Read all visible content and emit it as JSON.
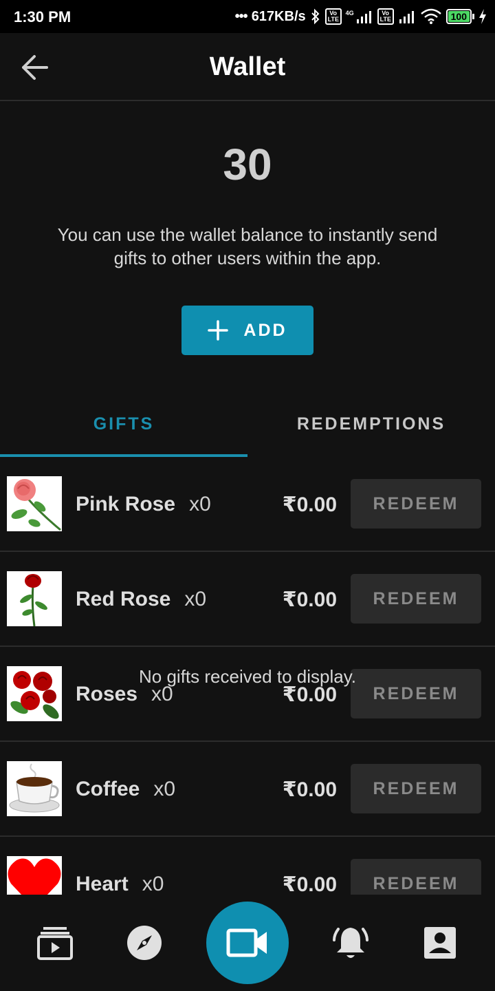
{
  "status_bar": {
    "time": "1:30 PM",
    "network_speed": "617KB/s",
    "battery": "100",
    "net_label": "4G",
    "volte_1": "Vo LTE",
    "volte_2": "Vo LTE"
  },
  "app_bar": {
    "title": "Wallet"
  },
  "wallet": {
    "balance": "30",
    "description": "You can use the wallet balance to instantly send gifts to other users within the app.",
    "add_label": "ADD"
  },
  "tabs": [
    {
      "label": "GIFTS",
      "active": true
    },
    {
      "label": "REDEMPTIONS",
      "active": false
    }
  ],
  "accent_color": "#0f8fb0",
  "gifts": [
    {
      "name": "Pink Rose",
      "qty": "x0",
      "price": "₹0.00",
      "action": "REDEEM",
      "icon": "pink-rose-icon"
    },
    {
      "name": "Red Rose",
      "qty": "x0",
      "price": "₹0.00",
      "action": "REDEEM",
      "icon": "red-rose-icon"
    },
    {
      "name": "Roses",
      "qty": "x0",
      "price": "₹0.00",
      "action": "REDEEM",
      "icon": "roses-bouquet-icon"
    },
    {
      "name": "Coffee",
      "qty": "x0",
      "price": "₹0.00",
      "action": "REDEEM",
      "icon": "coffee-cup-icon"
    },
    {
      "name": "Heart",
      "qty": "x0",
      "price": "₹0.00",
      "action": "REDEEM",
      "icon": "heart-icon"
    }
  ],
  "empty_message": "No gifts received to display.",
  "bottom_nav": [
    "feed-icon",
    "explore-compass-icon",
    "video-call-icon",
    "notifications-bell-icon",
    "profile-icon"
  ]
}
